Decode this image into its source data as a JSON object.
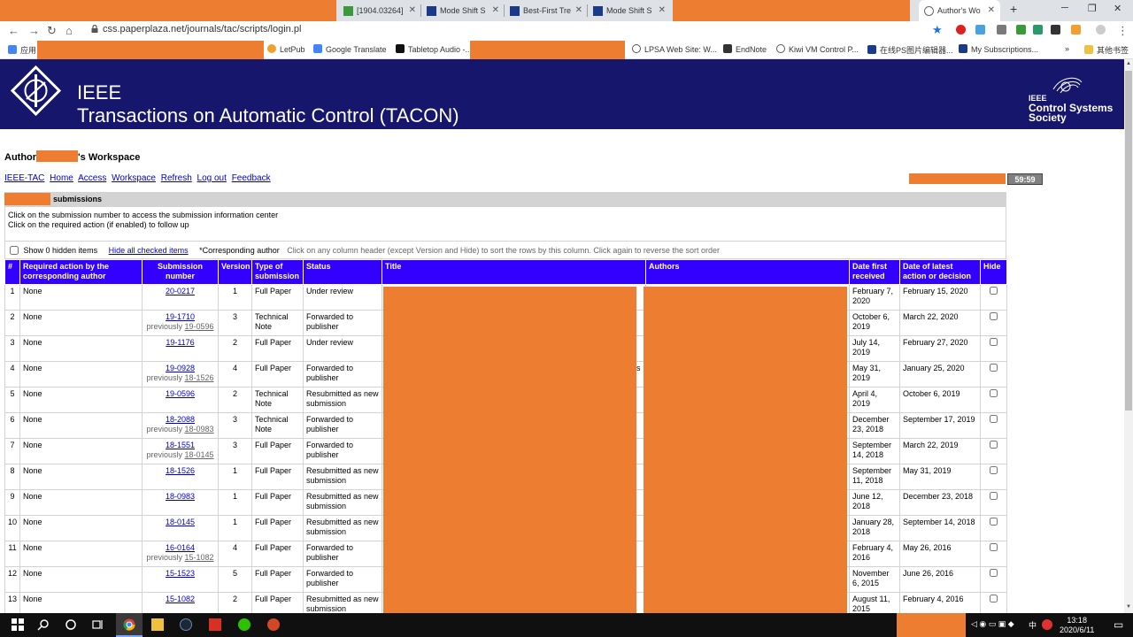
{
  "browser": {
    "tabs": [
      {
        "label": "[1904.03264]",
        "active": false
      },
      {
        "label": "Mode Shift S",
        "active": false
      },
      {
        "label": "Best-First Tre",
        "active": false
      },
      {
        "label": "Mode Shift S",
        "active": false
      },
      {
        "label": "Author's Wo",
        "active": true
      }
    ],
    "new_tab": "+",
    "url": "css.paperplaza.net/journals/tac/scripts/login.pl",
    "bookmarks": [
      "应用",
      "LetPub",
      "Google Translate",
      "Tabletop Audio -...",
      "LPSA Web Site: W...",
      "EndNote",
      "Kiwi VM Control P...",
      "在线PS图片编辑器...",
      "My Subscriptions...",
      "其他书签"
    ],
    "bookmarks_more": "»"
  },
  "header": {
    "org": "IEEE",
    "journal": "Transactions on Automatic Control (TACON)",
    "society_line1": "IEEE",
    "society_line2": "Control Systems",
    "society_line3": "Society"
  },
  "workspace": {
    "title_prefix": "Author",
    "title_suffix": "'s Workspace",
    "links": [
      "IEEE-TAC",
      "Home",
      "Access",
      "Workspace",
      "Refresh",
      "Log out",
      "Feedback"
    ],
    "timer": "59:59"
  },
  "submissions": {
    "heading": "submissions",
    "instruction1": "Click on the submission number to access the submission information center",
    "instruction2": "Click on the required action (if enabled) to follow up",
    "show_hidden": "Show 0 hidden items",
    "hide_checked": "Hide all checked items",
    "corresponding_note": "*Corresponding author",
    "sort_hint": "Click on any column header (except Version and Hide) to sort the rows by this column. Click again to reverse the sort order",
    "columns": [
      "#",
      "Required action by the corresponding author",
      "Submission number",
      "Version",
      "Type of submission",
      "Status",
      "Title",
      "Authors",
      "Date first received",
      "Date of latest action or decision",
      "Hide"
    ],
    "stray_text": "s",
    "rows": [
      {
        "n": "1",
        "action": "None",
        "sub": "20-0217",
        "prev": "",
        "ver": "1",
        "type": "Full Paper",
        "status": "Under review",
        "first": "February 7, 2020",
        "latest": "February 15, 2020"
      },
      {
        "n": "2",
        "action": "None",
        "sub": "19-1710",
        "prev": "19-0596",
        "ver": "3",
        "type": "Technical Note",
        "status": "Forwarded to publisher",
        "first": "October 6, 2019",
        "latest": "March 22, 2020"
      },
      {
        "n": "3",
        "action": "None",
        "sub": "19-1176",
        "prev": "",
        "ver": "2",
        "type": "Full Paper",
        "status": "Under review",
        "first": "July 14, 2019",
        "latest": "February 27, 2020"
      },
      {
        "n": "4",
        "action": "None",
        "sub": "19-0928",
        "prev": "18-1526",
        "ver": "4",
        "type": "Full Paper",
        "status": "Forwarded to publisher",
        "first": "May 31, 2019",
        "latest": "January 25, 2020"
      },
      {
        "n": "5",
        "action": "None",
        "sub": "19-0596",
        "prev": "",
        "ver": "2",
        "type": "Technical Note",
        "status": "Resubmitted as new submission",
        "first": "April 4, 2019",
        "latest": "October 6, 2019"
      },
      {
        "n": "6",
        "action": "None",
        "sub": "18-2088",
        "prev": "18-0983",
        "ver": "3",
        "type": "Technical Note",
        "status": "Forwarded to publisher",
        "first": "December 23, 2018",
        "latest": "September 17, 2019"
      },
      {
        "n": "7",
        "action": "None",
        "sub": "18-1551",
        "prev": "18-0145",
        "ver": "3",
        "type": "Full Paper",
        "status": "Forwarded to publisher",
        "first": "September 14, 2018",
        "latest": "March 22, 2019"
      },
      {
        "n": "8",
        "action": "None",
        "sub": "18-1526",
        "prev": "",
        "ver": "1",
        "type": "Full Paper",
        "status": "Resubmitted as new submission",
        "first": "September 11, 2018",
        "latest": "May 31, 2019"
      },
      {
        "n": "9",
        "action": "None",
        "sub": "18-0983",
        "prev": "",
        "ver": "1",
        "type": "Full Paper",
        "status": "Resubmitted as new submission",
        "first": "June 12, 2018",
        "latest": "December 23, 2018"
      },
      {
        "n": "10",
        "action": "None",
        "sub": "18-0145",
        "prev": "",
        "ver": "1",
        "type": "Full Paper",
        "status": "Resubmitted as new submission",
        "first": "January 28, 2018",
        "latest": "September 14, 2018"
      },
      {
        "n": "11",
        "action": "None",
        "sub": "16-0164",
        "prev": "15-1082",
        "ver": "4",
        "type": "Full Paper",
        "status": "Forwarded to publisher",
        "first": "February 4, 2016",
        "latest": "May 26, 2016"
      },
      {
        "n": "12",
        "action": "None",
        "sub": "15-1523",
        "prev": "",
        "ver": "5",
        "type": "Full Paper",
        "status": "Forwarded to publisher",
        "first": "November 6, 2015",
        "latest": "June 26, 2016"
      },
      {
        "n": "13",
        "action": "None",
        "sub": "15-1082",
        "prev": "",
        "ver": "2",
        "type": "Full Paper",
        "status": "Resubmitted as new submission",
        "first": "August 11, 2015",
        "latest": "February 4, 2016"
      }
    ],
    "previously_label": "previously"
  },
  "taskbar": {
    "time": "13:18",
    "date": "2020/6/11",
    "ime": "中"
  },
  "colors": {
    "banner": "#16166c",
    "table_header": "#3300ff",
    "redaction": "#ed7d31",
    "link": "#0000cc"
  }
}
